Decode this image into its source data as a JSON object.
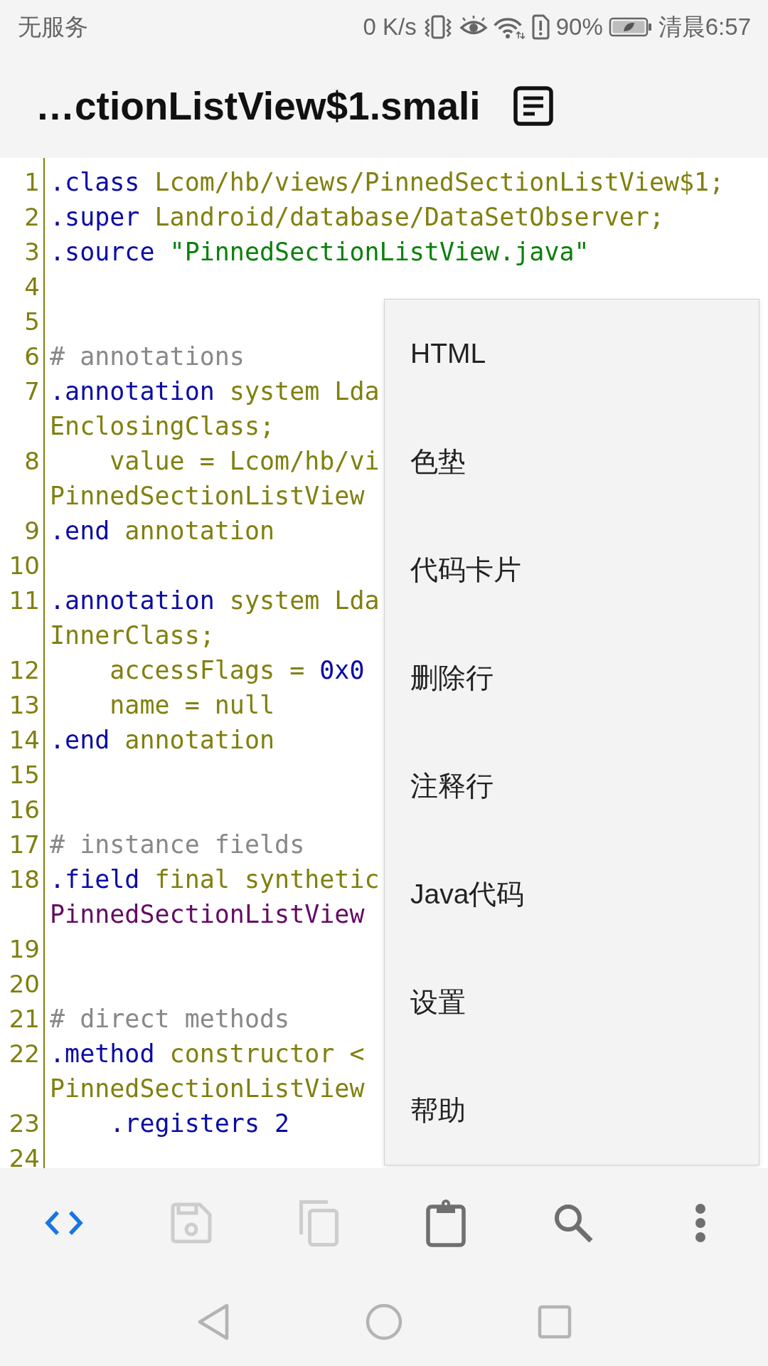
{
  "status_bar": {
    "carrier": "无服务",
    "network_speed": "0 K/s",
    "battery_percent": "90%",
    "time": "清晨6:57"
  },
  "title_bar": {
    "title": "…ctionListView$1.smali"
  },
  "editor": {
    "lines": [
      {
        "number": "1",
        "rows": [
          [
            {
              "kind": "directive",
              "text": ".class"
            },
            {
              "kind": "plain",
              "text": " Lcom/hb/views/PinnedSectionListView$1;"
            }
          ]
        ]
      },
      {
        "number": "2",
        "rows": [
          [
            {
              "kind": "directive",
              "text": ".super"
            },
            {
              "kind": "plain",
              "text": " Landroid/database/DataSetObserver;"
            }
          ]
        ]
      },
      {
        "number": "3",
        "rows": [
          [
            {
              "kind": "directive",
              "text": ".source"
            },
            {
              "kind": "string",
              "text": " \"PinnedSectionListView.java\""
            }
          ]
        ]
      },
      {
        "number": "4"
      },
      {
        "number": "5"
      },
      {
        "number": "6",
        "rows": [
          [
            {
              "kind": "comment",
              "text": "# annotations"
            }
          ]
        ]
      },
      {
        "number": "7",
        "rows": [
          [
            {
              "kind": "directive",
              "text": ".annotation"
            },
            {
              "kind": "plain",
              "text": " system Lda"
            }
          ],
          [
            {
              "kind": "plain",
              "text": "EnclosingClass;"
            }
          ]
        ]
      },
      {
        "number": "8",
        "rows": [
          [
            {
              "kind": "plain",
              "text": "    value = Lcom/hb/vi"
            }
          ],
          [
            {
              "kind": "plain",
              "text": "PinnedSectionListView"
            }
          ]
        ]
      },
      {
        "number": "9",
        "rows": [
          [
            {
              "kind": "directive",
              "text": ".end"
            },
            {
              "kind": "plain",
              "text": " annotation"
            }
          ]
        ]
      },
      {
        "number": "10"
      },
      {
        "number": "11",
        "rows": [
          [
            {
              "kind": "directive",
              "text": ".annotation"
            },
            {
              "kind": "plain",
              "text": " system Lda"
            }
          ],
          [
            {
              "kind": "plain",
              "text": "InnerClass;"
            }
          ]
        ]
      },
      {
        "number": "12",
        "rows": [
          [
            {
              "kind": "plain",
              "text": "    accessFlags = "
            },
            {
              "kind": "number",
              "text": "0x0"
            }
          ]
        ]
      },
      {
        "number": "13",
        "rows": [
          [
            {
              "kind": "plain",
              "text": "    name = null"
            }
          ]
        ]
      },
      {
        "number": "14",
        "rows": [
          [
            {
              "kind": "directive",
              "text": ".end"
            },
            {
              "kind": "plain",
              "text": " annotation"
            }
          ]
        ]
      },
      {
        "number": "15"
      },
      {
        "number": "16"
      },
      {
        "number": "17",
        "rows": [
          [
            {
              "kind": "comment",
              "text": "# instance fields"
            }
          ]
        ]
      },
      {
        "number": "18",
        "rows": [
          [
            {
              "kind": "directive",
              "text": ".field"
            },
            {
              "kind": "plain",
              "text": " final synthetic"
            }
          ],
          [
            {
              "kind": "type",
              "text": "PinnedSectionListView"
            }
          ]
        ]
      },
      {
        "number": "19"
      },
      {
        "number": "20"
      },
      {
        "number": "21",
        "rows": [
          [
            {
              "kind": "comment",
              "text": "# direct methods"
            }
          ]
        ]
      },
      {
        "number": "22",
        "rows": [
          [
            {
              "kind": "directive",
              "text": ".method"
            },
            {
              "kind": "plain",
              "text": " constructor <"
            }
          ],
          [
            {
              "kind": "plain",
              "text": "PinnedSectionListView"
            }
          ]
        ]
      },
      {
        "number": "23",
        "rows": [
          [
            {
              "kind": "directive",
              "text": "    .registers 2"
            }
          ]
        ]
      },
      {
        "number": "24"
      }
    ]
  },
  "menu": {
    "items": [
      {
        "label": "HTML"
      },
      {
        "label": "色垫"
      },
      {
        "label": "代码卡片"
      },
      {
        "label": "删除行"
      },
      {
        "label": "注释行"
      },
      {
        "label": "Java代码"
      },
      {
        "label": "设置"
      },
      {
        "label": "帮助"
      }
    ]
  },
  "toolbar": [
    {
      "kind": "code",
      "active": true,
      "disabled": false
    },
    {
      "kind": "save",
      "active": false,
      "disabled": true
    },
    {
      "kind": "copy",
      "active": false,
      "disabled": true
    },
    {
      "kind": "paste",
      "active": false,
      "disabled": false
    },
    {
      "kind": "search",
      "active": false,
      "disabled": false
    },
    {
      "kind": "more",
      "active": false,
      "disabled": false
    }
  ],
  "nav_bar": [
    {
      "kind": "back"
    },
    {
      "kind": "home"
    },
    {
      "kind": "recents"
    }
  ]
}
